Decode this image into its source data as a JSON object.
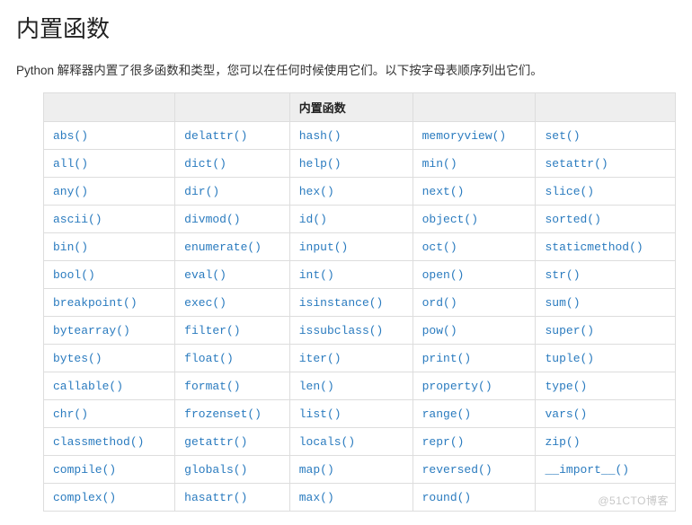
{
  "title": "内置函数",
  "intro": "Python 解释器内置了很多函数和类型，您可以在任何时候使用它们。以下按字母表顺序列出它们。",
  "table_header": [
    "",
    "",
    "内置函数",
    "",
    ""
  ],
  "rows": [
    [
      "abs()",
      "delattr()",
      "hash()",
      "memoryview()",
      "set()"
    ],
    [
      "all()",
      "dict()",
      "help()",
      "min()",
      "setattr()"
    ],
    [
      "any()",
      "dir()",
      "hex()",
      "next()",
      "slice()"
    ],
    [
      "ascii()",
      "divmod()",
      "id()",
      "object()",
      "sorted()"
    ],
    [
      "bin()",
      "enumerate()",
      "input()",
      "oct()",
      "staticmethod()"
    ],
    [
      "bool()",
      "eval()",
      "int()",
      "open()",
      "str()"
    ],
    [
      "breakpoint()",
      "exec()",
      "isinstance()",
      "ord()",
      "sum()"
    ],
    [
      "bytearray()",
      "filter()",
      "issubclass()",
      "pow()",
      "super()"
    ],
    [
      "bytes()",
      "float()",
      "iter()",
      "print()",
      "tuple()"
    ],
    [
      "callable()",
      "format()",
      "len()",
      "property()",
      "type()"
    ],
    [
      "chr()",
      "frozenset()",
      "list()",
      "range()",
      "vars()"
    ],
    [
      "classmethod()",
      "getattr()",
      "locals()",
      "repr()",
      "zip()"
    ],
    [
      "compile()",
      "globals()",
      "map()",
      "reversed()",
      "__import__()"
    ],
    [
      "complex()",
      "hasattr()",
      "max()",
      "round()",
      ""
    ]
  ],
  "watermark": "@51CTO博客"
}
